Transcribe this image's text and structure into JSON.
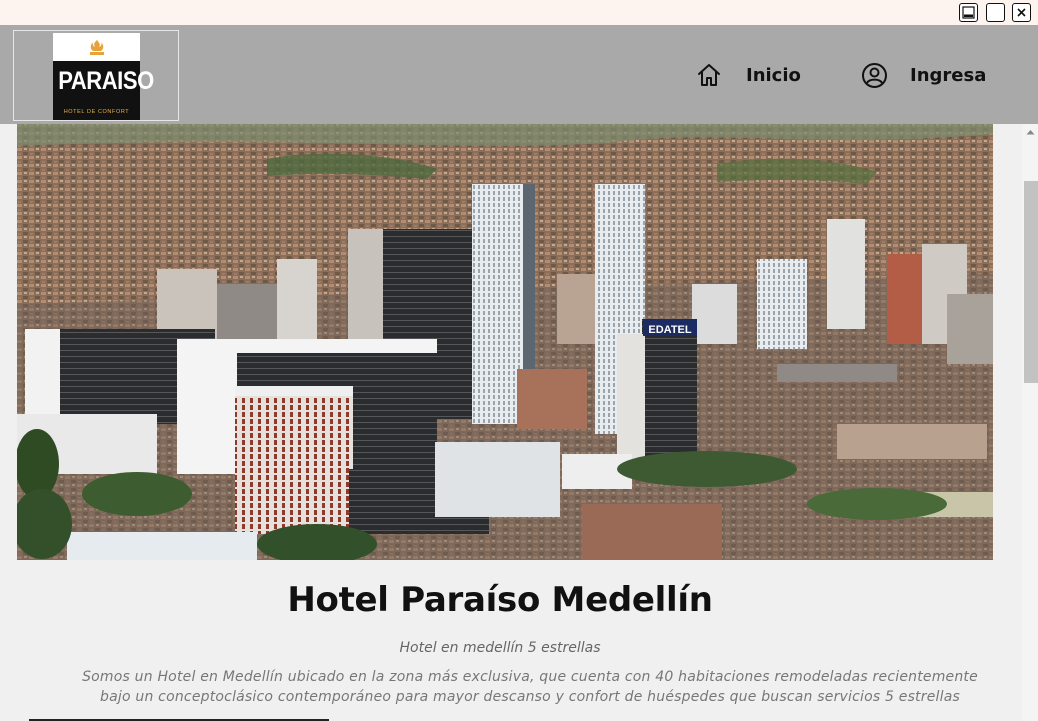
{
  "window": {
    "controls": [
      "minimize-icon",
      "maximize-icon",
      "close-icon"
    ]
  },
  "header": {
    "logo": {
      "name": "PARAISO",
      "tagline": "HOTEL DE CONFORT"
    },
    "nav": [
      {
        "label": "Inicio",
        "icon": "home-icon"
      },
      {
        "label": "Ingresa",
        "icon": "user-icon"
      }
    ]
  },
  "hero": {
    "sign_text": "EDATEL",
    "image_subject": "city skyline"
  },
  "content": {
    "title": "Hotel Paraíso Medellín",
    "subtitle": "Hotel en medellín 5 estrellas",
    "description_line1": "Somos un Hotel  en Medellín ubicado en la zona más exclusiva, que cuenta con 40 habitaciones remodeladas recientemente",
    "description_line2": "bajo un conceptoclásico contemporáneo para mayor descanso y confort de huéspedes que buscan servicios 5 estrellas"
  },
  "colors": {
    "header_bg": "#a9a9a9",
    "content_bg": "#f0f0f0",
    "logo_accent": "#e7b24a",
    "text": "#111111"
  }
}
